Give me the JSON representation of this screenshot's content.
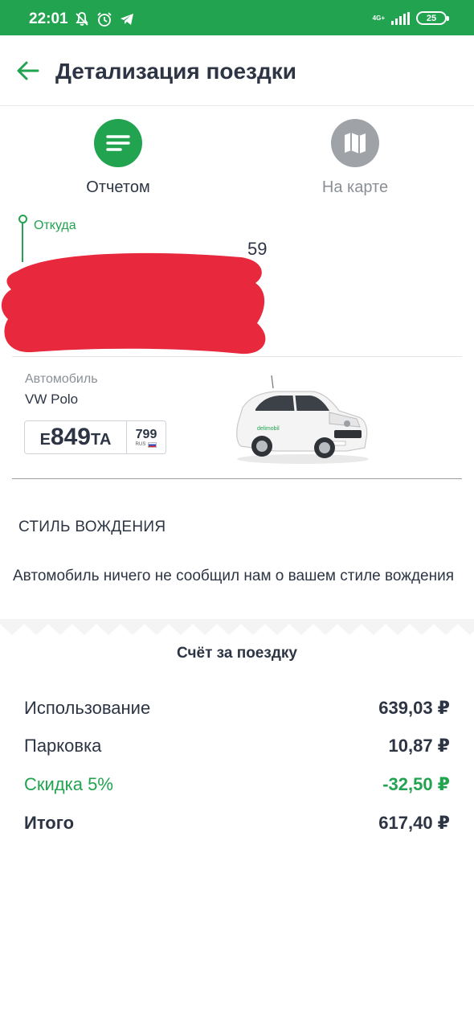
{
  "status_bar": {
    "time": "22:01",
    "network": "4G+",
    "battery": "25",
    "icons": [
      "vibrate-off-icon",
      "alarm-icon",
      "telegram-icon",
      "signal-icon",
      "battery-icon"
    ]
  },
  "header": {
    "title": "Детализация поездки",
    "back_icon": "arrow-left-icon"
  },
  "tabs": [
    {
      "label": "Отчетом",
      "icon": "list-icon",
      "active": true
    },
    {
      "label": "На карте",
      "icon": "map-icon",
      "active": false
    }
  ],
  "route": {
    "from_label": "Откуда",
    "from_address_visible": "59"
  },
  "car": {
    "label": "Автомобиль",
    "model": "VW Polo",
    "plate": {
      "letter1": "Е",
      "number": "849",
      "letters2": "ТА",
      "region": "799",
      "country": "RUS"
    }
  },
  "driving_style": {
    "title": "СТИЛЬ ВОЖДЕНИЯ",
    "text": "Автомобиль ничего не сообщил нам о вашем стиле вождения"
  },
  "bill": {
    "title": "Счёт за поездку",
    "rows": [
      {
        "name": "Использование",
        "amount": "639,03 ₽"
      },
      {
        "name": "Парковка",
        "amount": "10,87 ₽"
      },
      {
        "name": "Скидка 5%",
        "amount": "-32,50 ₽"
      },
      {
        "name": "Итого",
        "amount": "617,40 ₽"
      }
    ]
  },
  "colors": {
    "accent": "#21a34f",
    "text": "#2d3544",
    "muted": "#8a8f96",
    "redaction": "#e8283c"
  }
}
